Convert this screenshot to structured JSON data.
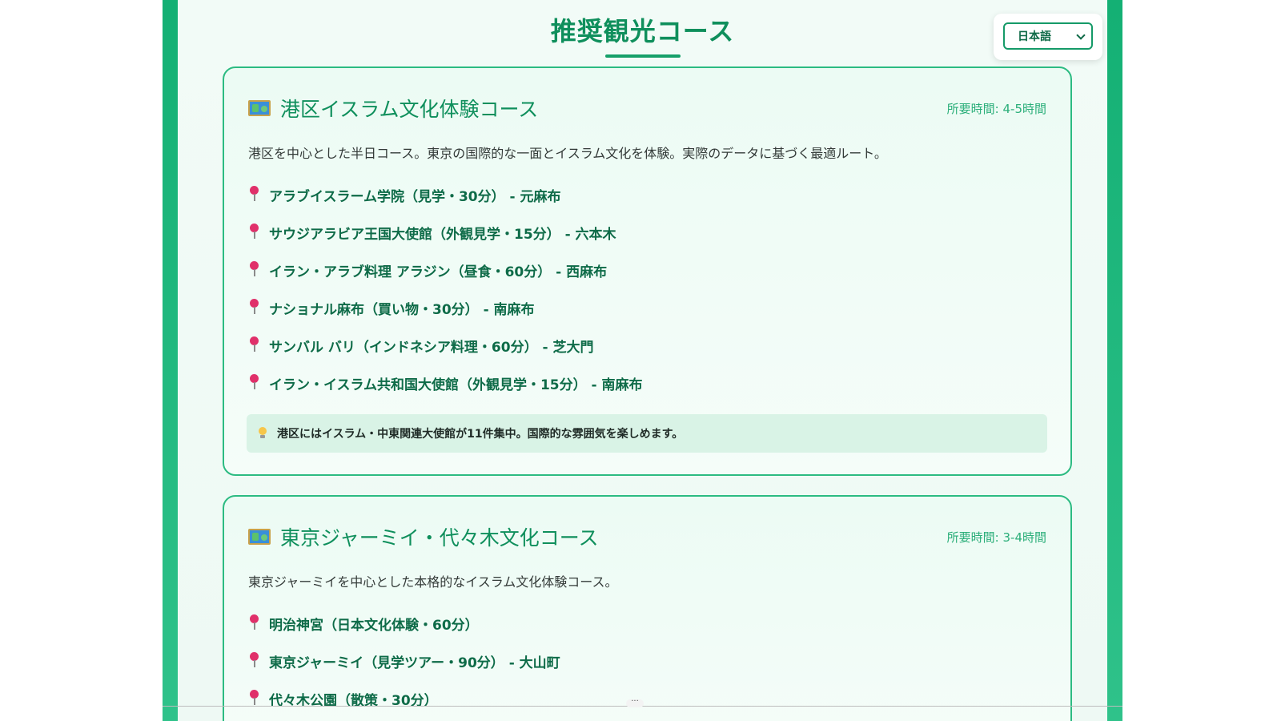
{
  "page": {
    "title": "推奨観光コース"
  },
  "language_selector": {
    "value": "日本語"
  },
  "courses": [
    {
      "icon": "map-icon",
      "title": "港区イスラム文化体験コース",
      "duration": "所要時間: 4-5時間",
      "description": "港区を中心とした半日コース。東京の国際的な一面とイスラム文化を体験。実際のデータに基づく最適ルート。",
      "stops": [
        "アラブイスラーム学院（見学・30分） - 元麻布",
        "サウジアラビア王国大使館（外観見学・15分） - 六本木",
        "イラン・アラブ料理 アラジン（昼食・60分） - 西麻布",
        "ナショナル麻布（買い物・30分） - 南麻布",
        "サンバル バリ（インドネシア料理・60分） - 芝大門",
        "イラン・イスラム共和国大使館（外観見学・15分） - 南麻布"
      ],
      "tip": "港区にはイスラム・中東関連大使館が11件集中。国際的な雰囲気を楽しめます。"
    },
    {
      "icon": "map-icon",
      "title": "東京ジャーミイ・代々木文化コース",
      "duration": "所要時間: 3-4時間",
      "description": "東京ジャーミイを中心とした本格的なイスラム文化体験コース。",
      "stops": [
        "明治神宮（日本文化体験・60分）",
        "東京ジャーミイ（見学ツアー・90分） - 大山町",
        "代々木公園（散策・30分）"
      ]
    }
  ],
  "colors": {
    "accent": "#0f8f5c",
    "frame": "#14b074",
    "card_border": "#2cbb82",
    "pin": "#e0306a"
  }
}
